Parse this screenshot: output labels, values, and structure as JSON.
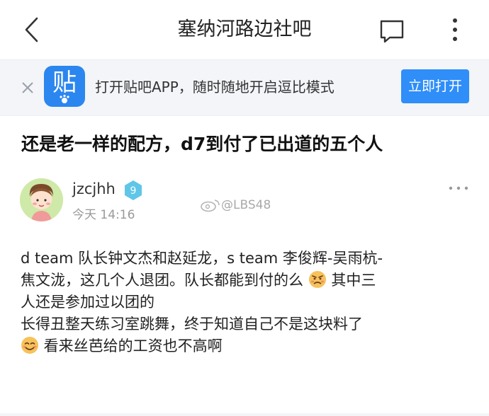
{
  "header": {
    "title": "塞纳河路边社吧"
  },
  "banner": {
    "logo_text": "贴",
    "message": "打开贴吧APP，随时随地开启逗比模式",
    "open_label": "立即打开"
  },
  "post": {
    "title": "还是老一样的配方，d7到付了已出道的五个人",
    "author": {
      "name": "jzcjhh",
      "level": "9"
    },
    "time": "今天 14:16",
    "watermark": "@LBS48",
    "lines": [
      {
        "text": "d team 队长钟文杰和赵延龙，s team 李俊辉-吴雨杭-",
        "emoji_after": null
      },
      {
        "text": "焦文泷，这几个人退团。队长都能到付的么",
        "emoji_after": "angry-face",
        "tail": " 其中三"
      },
      {
        "text": "人还是参加过以团的",
        "emoji_after": null
      },
      {
        "text": "长得丑整天练习室跳舞，终于知道自己不是这块料了",
        "emoji_after": null
      },
      {
        "text": " 看来丝芭给的工资也不高啊",
        "emoji_before": "smile-face"
      }
    ]
  },
  "colors": {
    "accent": "#2f8ef8",
    "banner_bg": "#f3f5f8"
  }
}
